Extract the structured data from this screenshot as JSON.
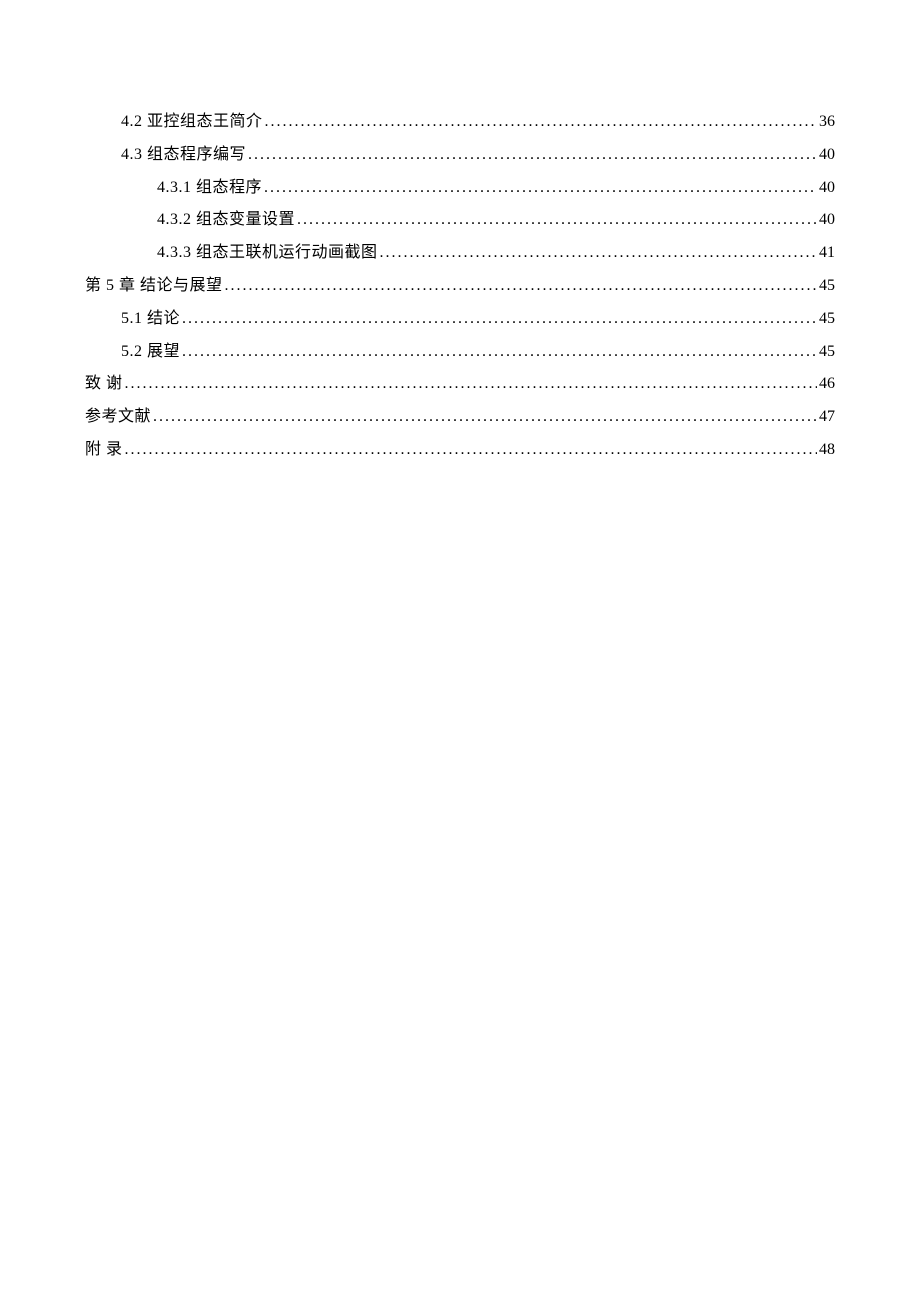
{
  "toc": [
    {
      "indent": 1,
      "label": "4.2 亚控组态王简介",
      "page": "36"
    },
    {
      "indent": 1,
      "label": "4.3 组态程序编写",
      "page": "40"
    },
    {
      "indent": 2,
      "label": "4.3.1 组态程序",
      "page": "40"
    },
    {
      "indent": 2,
      "label": "4.3.2 组态变量设置",
      "page": "40"
    },
    {
      "indent": 2,
      "label": "4.3.3 组态王联机运行动画截图",
      "page": "41"
    },
    {
      "indent": 0,
      "label": "第 5 章  结论与展望",
      "page": "45"
    },
    {
      "indent": 1,
      "label": "5.1 结论",
      "page": "45"
    },
    {
      "indent": 1,
      "label": "5.2 展望",
      "page": "45"
    },
    {
      "indent": 0,
      "label": "致   谢",
      "page": "46"
    },
    {
      "indent": 0,
      "label": "参考文献",
      "page": "47"
    },
    {
      "indent": 0,
      "label": "附   录",
      "page": "48"
    }
  ]
}
